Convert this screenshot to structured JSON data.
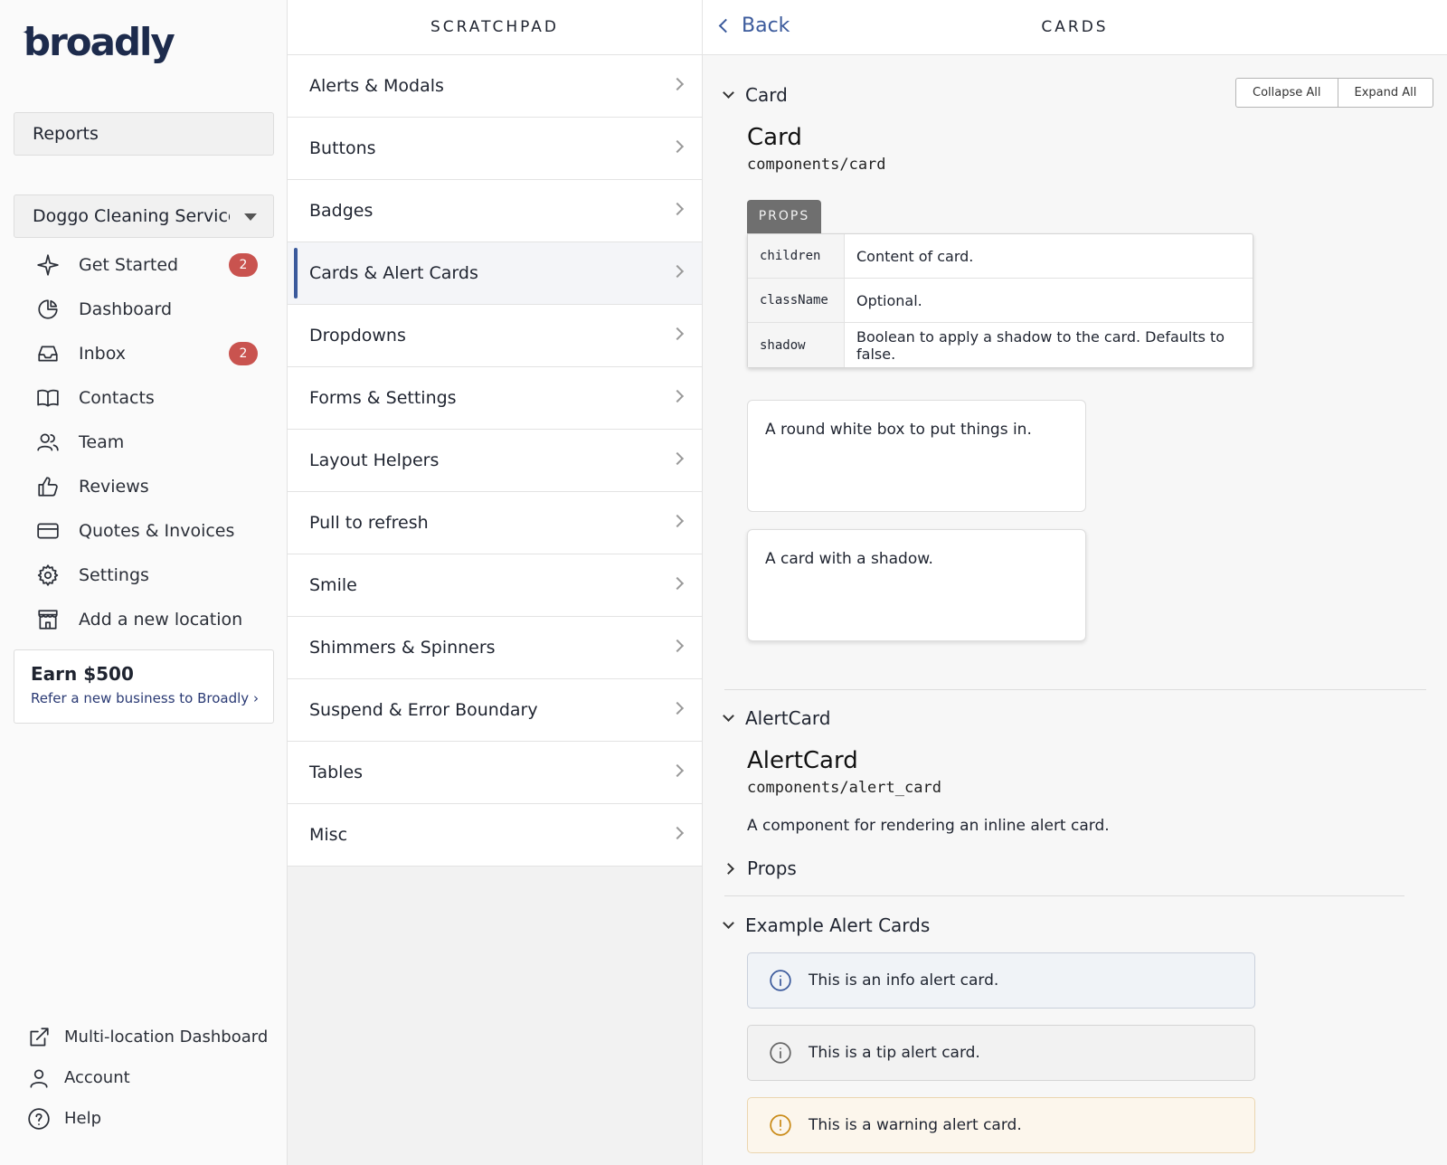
{
  "brand": {
    "logo_text": "broadly"
  },
  "sidebar": {
    "reports_label": "Reports",
    "location": "Doggo Cleaning Services",
    "items": [
      {
        "label": "Get Started",
        "badge": "2"
      },
      {
        "label": "Dashboard"
      },
      {
        "label": "Inbox",
        "badge": "2"
      },
      {
        "label": "Contacts"
      },
      {
        "label": "Team"
      },
      {
        "label": "Reviews"
      },
      {
        "label": "Quotes & Invoices"
      },
      {
        "label": "Settings"
      },
      {
        "label": "Add a new location"
      }
    ],
    "earn": {
      "title": "Earn $500",
      "link": "Refer a new business to Broadly"
    },
    "bottom": [
      {
        "label": "Multi-location Dashboard"
      },
      {
        "label": "Account"
      },
      {
        "label": "Help"
      }
    ]
  },
  "scratchpad": {
    "title": "SCRATCHPAD",
    "items": [
      "Alerts & Modals",
      "Buttons",
      "Badges",
      "Cards & Alert Cards",
      "Dropdowns",
      "Forms & Settings",
      "Layout Helpers",
      "Pull to refresh",
      "Smile",
      "Shimmers & Spinners",
      "Suspend & Error Boundary",
      "Tables",
      "Misc"
    ],
    "active_index": 3
  },
  "detail": {
    "back_label": "Back",
    "title": "CARDS",
    "collapse_all": "Collapse All",
    "expand_all": "Expand All",
    "card_section": {
      "toggle": "Card",
      "title": "Card",
      "path": "components/card",
      "props_tab": "PROPS",
      "props": [
        {
          "name": "children",
          "desc": "Content of card."
        },
        {
          "name": "className",
          "desc": "Optional."
        },
        {
          "name": "shadow",
          "desc": "Boolean to apply a shadow to the card. Defaults to false."
        }
      ],
      "demo_plain": "A round white box to put things in.",
      "demo_shadow": "A card with a shadow."
    },
    "alert_section": {
      "toggle": "AlertCard",
      "title": "AlertCard",
      "path": "components/alert_card",
      "description": "A component for rendering an inline alert card.",
      "props_toggle": "Props",
      "examples_toggle": "Example Alert Cards",
      "alerts": {
        "info": "This is an info alert card.",
        "tip": "This is a tip alert card.",
        "warning": "This is a warning alert card."
      }
    }
  },
  "colors": {
    "accent": "#3b5a9c",
    "badge": "#c9534f",
    "warning_icon": "#c98a16"
  }
}
